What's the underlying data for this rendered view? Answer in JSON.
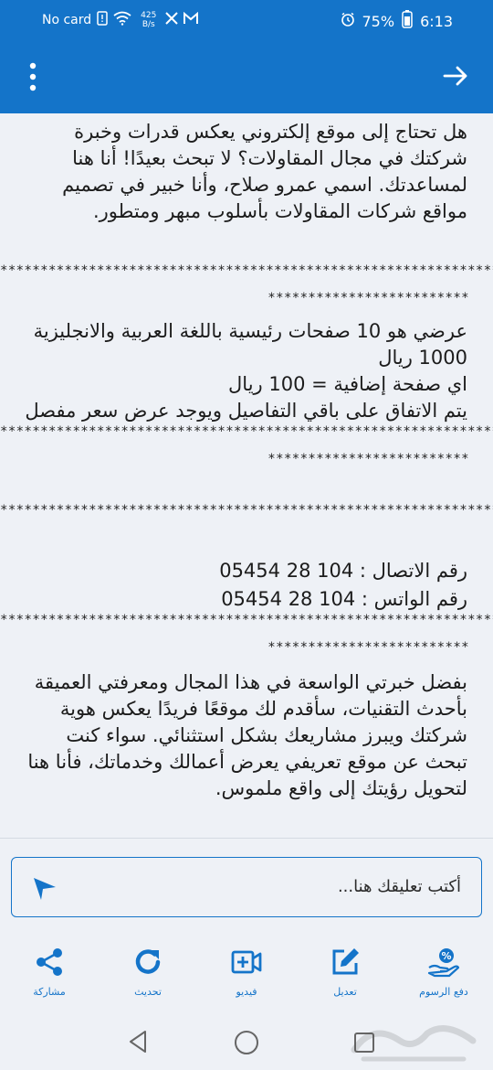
{
  "status_bar": {
    "carrier": "No card",
    "speed_value": "425",
    "speed_unit": "B/s",
    "battery": "75%",
    "time": "6:13"
  },
  "app_bar": {
    "menu_icon": "more-vertical-icon",
    "back_icon": "arrow-right-icon"
  },
  "post": {
    "intro": "هل تحتاج إلى موقع إلكتروني يعكس قدرات وخبرة شركتك في مجال المقاولات؟ لا تبحث بعيدًا! أنا هنا لمساعدتك. اسمي عمرو صلاح، وأنا خبير في تصميم مواقع شركات المقاولات بأسلوب مبهر ومتطور.",
    "separator_long": "************************************************************************",
    "separator_short": "*************************",
    "offer_line1": "عرضي هو 10 صفحات رئيسية باللغة العربية والانجليزية 1000 ريال",
    "offer_line2": "اي صفحة إضافية = 100 ريال",
    "offer_line3": "يتم الاتفاق على باقي التفاصيل ويوجد عرض سعر مفصل",
    "phone_line": "رقم الاتصال : 104 28 05454",
    "whatsapp_line": "رقم الواتس : 104 28 05454",
    "closing": "بفضل خبرتي الواسعة في هذا المجال ومعرفتي العميقة بأحدث التقنيات، سأقدم لك موقعًا فريدًا يعكس هوية شركتك ويبرز مشاريعك بشكل استثنائي. سواء كنت تبحث عن موقع تعريفي يعرض أعمالك وخدماتك، فأنا هنا لتحويل رؤيتك إلى واقع ملموس."
  },
  "comment": {
    "placeholder": "أكتب تعليقك هنا...",
    "send_icon": "send-icon"
  },
  "toolbar": {
    "pay_fees": "دفع الرسوم",
    "edit": "تعديل",
    "video": "فيديو",
    "refresh": "تحديث",
    "share": "مشاركة"
  },
  "colors": {
    "brand_blue": "#1474c9",
    "background": "#eef1f6"
  }
}
